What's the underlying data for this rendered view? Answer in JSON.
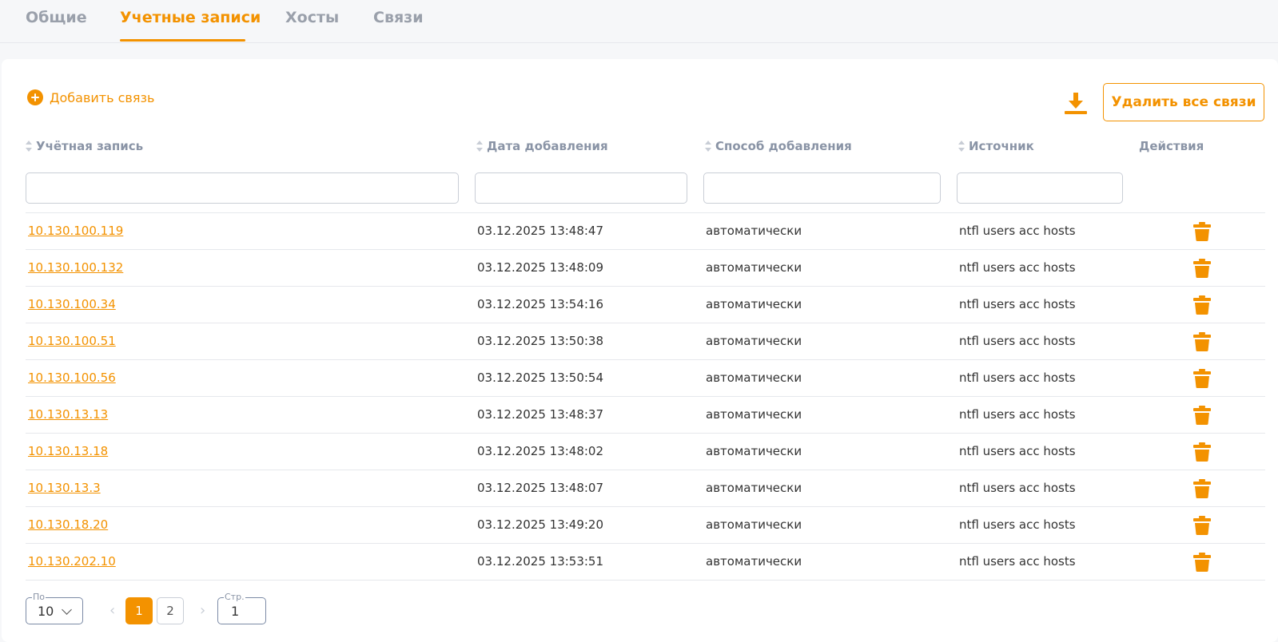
{
  "tabs": [
    {
      "label": "Общие",
      "active": false
    },
    {
      "label": "Учетные записи",
      "active": true
    },
    {
      "label": "Хосты",
      "active": false
    },
    {
      "label": "Связи",
      "active": false
    }
  ],
  "toolbar": {
    "add_label": "Добавить связь",
    "add_icon": "plus-circle-icon",
    "download_icon": "download-icon",
    "delete_all_label": "Удалить все связи"
  },
  "table": {
    "columns": [
      "Учётная запись",
      "Дата добавления",
      "Способ добавления",
      "Источник",
      "Действия"
    ],
    "filters": [
      "",
      "",
      "",
      ""
    ],
    "rows": [
      {
        "account": "10.130.100.119",
        "date": "03.12.2025 13:48:47",
        "method": "автоматически",
        "source": "ntfl users acc hosts"
      },
      {
        "account": "10.130.100.132",
        "date": "03.12.2025 13:48:09",
        "method": "автоматически",
        "source": "ntfl users acc hosts"
      },
      {
        "account": "10.130.100.34",
        "date": "03.12.2025 13:54:16",
        "method": "автоматически",
        "source": "ntfl users acc hosts"
      },
      {
        "account": "10.130.100.51",
        "date": "03.12.2025 13:50:38",
        "method": "автоматически",
        "source": "ntfl users acc hosts"
      },
      {
        "account": "10.130.100.56",
        "date": "03.12.2025 13:50:54",
        "method": "автоматически",
        "source": "ntfl users acc hosts"
      },
      {
        "account": "10.130.13.13",
        "date": "03.12.2025 13:48:37",
        "method": "автоматически",
        "source": "ntfl users acc hosts"
      },
      {
        "account": "10.130.13.18",
        "date": "03.12.2025 13:48:02",
        "method": "автоматически",
        "source": "ntfl users acc hosts"
      },
      {
        "account": "10.130.13.3",
        "date": "03.12.2025 13:48:07",
        "method": "автоматически",
        "source": "ntfl users acc hosts"
      },
      {
        "account": "10.130.18.20",
        "date": "03.12.2025 13:49:20",
        "method": "автоматически",
        "source": "ntfl users acc hosts"
      },
      {
        "account": "10.130.202.10",
        "date": "03.12.2025 13:53:51",
        "method": "автоматически",
        "source": "ntfl users acc hosts"
      }
    ],
    "row_action_icon": "trash-icon"
  },
  "pagination": {
    "per_page_label": "По",
    "per_page_value": "10",
    "pages": [
      "1",
      "2"
    ],
    "current_page": "1",
    "page_input_label": "Стр.",
    "page_input_value": "1"
  },
  "colors": {
    "accent": "#f39200",
    "muted": "#8a94a6",
    "border": "#e6e8ec"
  }
}
